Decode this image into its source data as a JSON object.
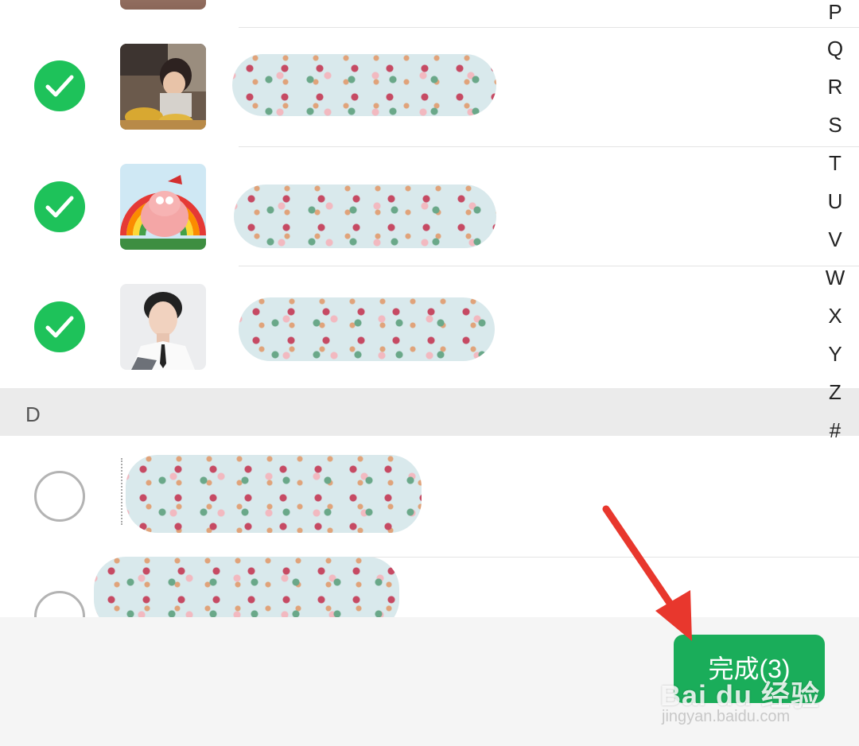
{
  "contacts": [
    {
      "selected": true,
      "avatar": "child-photo"
    },
    {
      "selected": true,
      "avatar": "patrick-star-rainbow"
    },
    {
      "selected": true,
      "avatar": "man-portrait"
    },
    {
      "selected": false,
      "avatar": "redacted"
    },
    {
      "selected": false,
      "avatar": "redacted"
    }
  ],
  "section_d": {
    "label": "D"
  },
  "alpha_index": [
    "P",
    "Q",
    "R",
    "S",
    "T",
    "U",
    "V",
    "W",
    "X",
    "Y",
    "Z",
    "#"
  ],
  "done_button": {
    "label": "完成(3)"
  },
  "watermark": {
    "brand": "Bai du 经验",
    "url": "jingyan.baidu.com"
  },
  "colors": {
    "accent": "#1aad5a",
    "check": "#1ec25a",
    "arrow": "#e8372d"
  }
}
